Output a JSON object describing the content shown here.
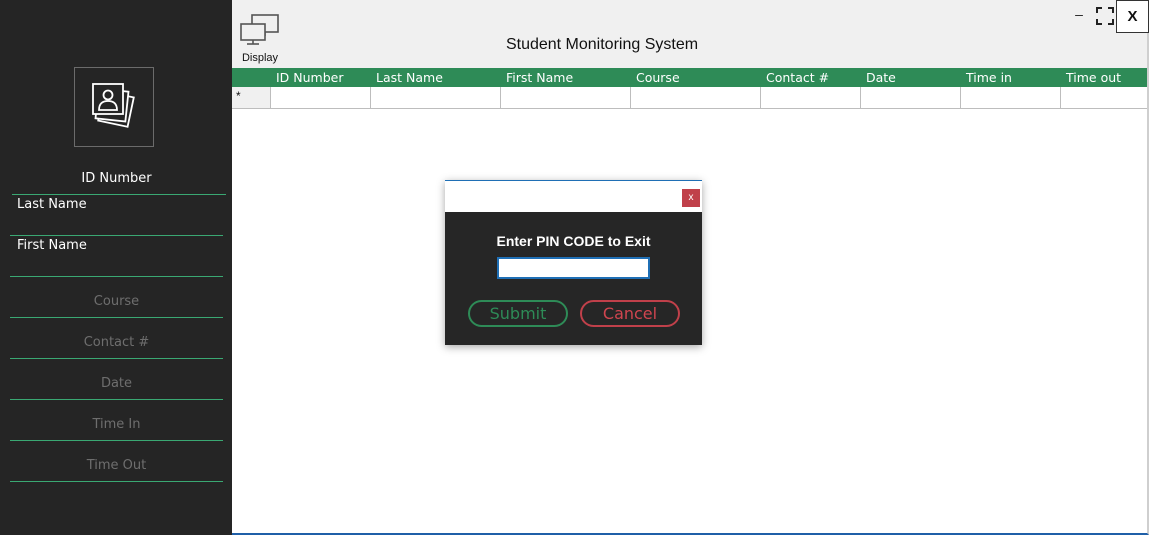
{
  "window": {
    "title": "Student Monitoring System",
    "minimize_glyph": "–",
    "close_glyph": "X"
  },
  "toolbar": {
    "display_label": "Display",
    "display_icon": "monitors-icon"
  },
  "sidebar": {
    "photo_icon": "photo-gallery-icon",
    "fields": {
      "id_number": "ID Number",
      "last_name": "Last Name",
      "first_name": "First Name",
      "course": "Course",
      "contact": "Contact #",
      "date": "Date",
      "time_in": "Time In",
      "time_out": "Time Out"
    }
  },
  "grid": {
    "columns": [
      "ID Number",
      "Last Name",
      "First Name",
      "Course",
      "Contact #",
      "Date",
      "Time in",
      "Time out"
    ],
    "new_row_marker": "*"
  },
  "pin_dialog": {
    "close_glyph": "x",
    "prompt": "Enter PIN CODE to Exit",
    "pin_value": "",
    "submit_label": "Submit",
    "cancel_label": "Cancel"
  },
  "colors": {
    "accent_green": "#2e8b57",
    "sidebar_bg": "#252525",
    "cancel_red": "#c0404a"
  }
}
